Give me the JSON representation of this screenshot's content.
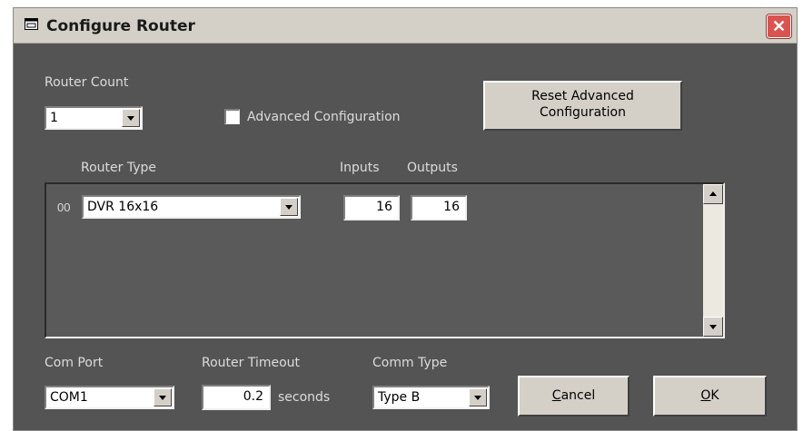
{
  "window": {
    "title": "Configure Router",
    "close_label": "✕"
  },
  "router_count": {
    "label": "Router Count",
    "value": "1"
  },
  "advanced": {
    "label": "Advanced Configuration",
    "checked": false
  },
  "reset_button": {
    "line1": "Reset Advanced",
    "line2": "Configuration"
  },
  "table": {
    "headers": {
      "router_type": "Router Type",
      "inputs": "Inputs",
      "outputs": "Outputs"
    },
    "rows": [
      {
        "index": "00",
        "router_type": "DVR 16x16",
        "inputs": "16",
        "outputs": "16"
      }
    ]
  },
  "com_port": {
    "label": "Com Port",
    "value": "COM1"
  },
  "router_timeout": {
    "label": "Router Timeout",
    "value": "0.2",
    "unit": "seconds"
  },
  "comm_type": {
    "label": "Comm Type",
    "value": "Type B"
  },
  "cancel_button": {
    "mnemonic": "C",
    "rest": "ancel"
  },
  "ok_button": {
    "mnemonic": "O",
    "rest": "K"
  }
}
